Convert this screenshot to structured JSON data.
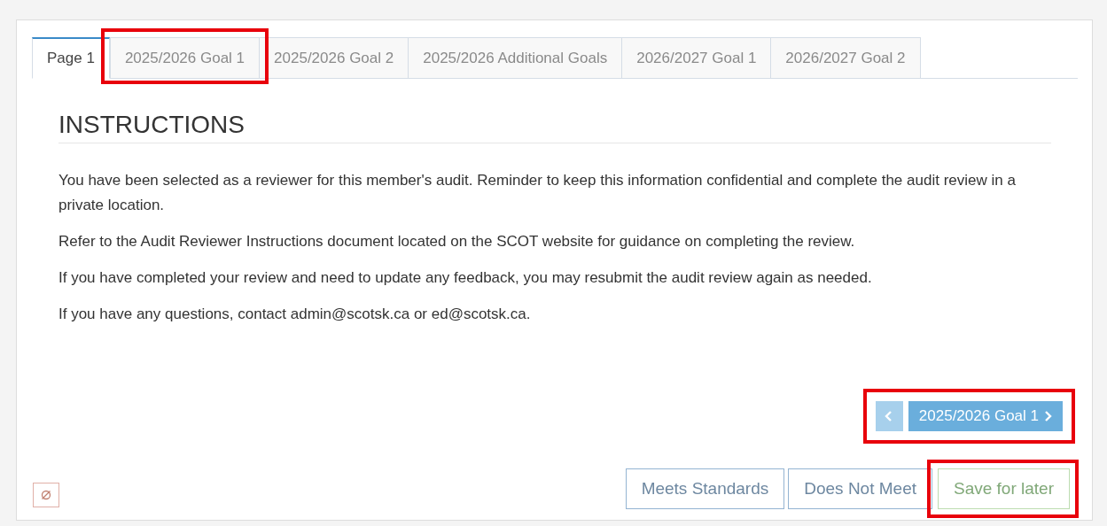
{
  "tabs": [
    {
      "label": "Page 1",
      "selected": true,
      "highlighted": false
    },
    {
      "label": "2025/2026 Goal 1",
      "selected": false,
      "highlighted": true
    },
    {
      "label": "2025/2026 Goal 2",
      "selected": false,
      "highlighted": false
    },
    {
      "label": "2025/2026 Additional Goals",
      "selected": false,
      "highlighted": false
    },
    {
      "label": "2026/2027 Goal 1",
      "selected": false,
      "highlighted": false
    },
    {
      "label": "2026/2027 Goal 2",
      "selected": false,
      "highlighted": false
    }
  ],
  "heading": "INSTRUCTIONS",
  "paragraphs": [
    "You have been selected as a reviewer for this member's audit. Reminder to keep this information confidential and complete the audit review in a private location.",
    "Refer to the Audit Reviewer Instructions document located on the SCOT website for guidance on completing the review.",
    "If you have completed your review and need to update any feedback, you may resubmit the audit review again as needed.",
    "If you have any questions, contact admin@scotsk.ca or ed@scotsk.ca."
  ],
  "pager": {
    "highlighted": true,
    "previous_disabled": true,
    "next_label": "2025/2026 Goal 1"
  },
  "actions": [
    {
      "label": "Meets Standards",
      "kind": "outline",
      "highlighted": false
    },
    {
      "label": "Does Not Meet",
      "kind": "outline",
      "highlighted": false
    },
    {
      "label": "Save for later",
      "kind": "success",
      "highlighted": true
    }
  ]
}
